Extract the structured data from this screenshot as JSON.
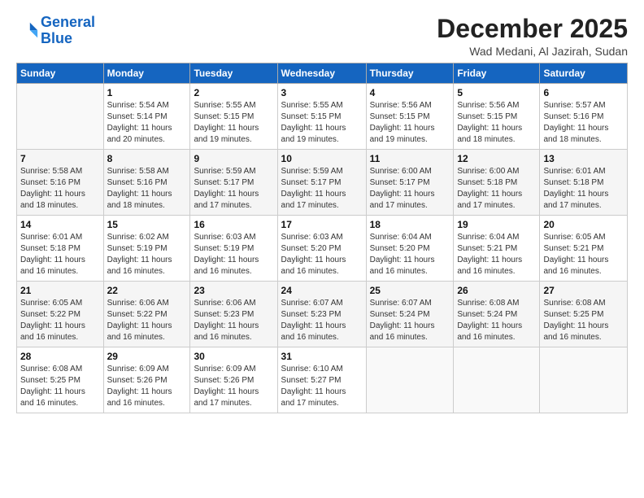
{
  "logo": {
    "line1": "General",
    "line2": "Blue"
  },
  "title": "December 2025",
  "location": "Wad Medani, Al Jazirah, Sudan",
  "days_of_week": [
    "Sunday",
    "Monday",
    "Tuesday",
    "Wednesday",
    "Thursday",
    "Friday",
    "Saturday"
  ],
  "weeks": [
    [
      {
        "day": "",
        "info": ""
      },
      {
        "day": "1",
        "info": "Sunrise: 5:54 AM\nSunset: 5:14 PM\nDaylight: 11 hours\nand 20 minutes."
      },
      {
        "day": "2",
        "info": "Sunrise: 5:55 AM\nSunset: 5:15 PM\nDaylight: 11 hours\nand 19 minutes."
      },
      {
        "day": "3",
        "info": "Sunrise: 5:55 AM\nSunset: 5:15 PM\nDaylight: 11 hours\nand 19 minutes."
      },
      {
        "day": "4",
        "info": "Sunrise: 5:56 AM\nSunset: 5:15 PM\nDaylight: 11 hours\nand 19 minutes."
      },
      {
        "day": "5",
        "info": "Sunrise: 5:56 AM\nSunset: 5:15 PM\nDaylight: 11 hours\nand 18 minutes."
      },
      {
        "day": "6",
        "info": "Sunrise: 5:57 AM\nSunset: 5:16 PM\nDaylight: 11 hours\nand 18 minutes."
      }
    ],
    [
      {
        "day": "7",
        "info": "Sunrise: 5:58 AM\nSunset: 5:16 PM\nDaylight: 11 hours\nand 18 minutes."
      },
      {
        "day": "8",
        "info": "Sunrise: 5:58 AM\nSunset: 5:16 PM\nDaylight: 11 hours\nand 18 minutes."
      },
      {
        "day": "9",
        "info": "Sunrise: 5:59 AM\nSunset: 5:17 PM\nDaylight: 11 hours\nand 17 minutes."
      },
      {
        "day": "10",
        "info": "Sunrise: 5:59 AM\nSunset: 5:17 PM\nDaylight: 11 hours\nand 17 minutes."
      },
      {
        "day": "11",
        "info": "Sunrise: 6:00 AM\nSunset: 5:17 PM\nDaylight: 11 hours\nand 17 minutes."
      },
      {
        "day": "12",
        "info": "Sunrise: 6:00 AM\nSunset: 5:18 PM\nDaylight: 11 hours\nand 17 minutes."
      },
      {
        "day": "13",
        "info": "Sunrise: 6:01 AM\nSunset: 5:18 PM\nDaylight: 11 hours\nand 17 minutes."
      }
    ],
    [
      {
        "day": "14",
        "info": "Sunrise: 6:01 AM\nSunset: 5:18 PM\nDaylight: 11 hours\nand 16 minutes."
      },
      {
        "day": "15",
        "info": "Sunrise: 6:02 AM\nSunset: 5:19 PM\nDaylight: 11 hours\nand 16 minutes."
      },
      {
        "day": "16",
        "info": "Sunrise: 6:03 AM\nSunset: 5:19 PM\nDaylight: 11 hours\nand 16 minutes."
      },
      {
        "day": "17",
        "info": "Sunrise: 6:03 AM\nSunset: 5:20 PM\nDaylight: 11 hours\nand 16 minutes."
      },
      {
        "day": "18",
        "info": "Sunrise: 6:04 AM\nSunset: 5:20 PM\nDaylight: 11 hours\nand 16 minutes."
      },
      {
        "day": "19",
        "info": "Sunrise: 6:04 AM\nSunset: 5:21 PM\nDaylight: 11 hours\nand 16 minutes."
      },
      {
        "day": "20",
        "info": "Sunrise: 6:05 AM\nSunset: 5:21 PM\nDaylight: 11 hours\nand 16 minutes."
      }
    ],
    [
      {
        "day": "21",
        "info": "Sunrise: 6:05 AM\nSunset: 5:22 PM\nDaylight: 11 hours\nand 16 minutes."
      },
      {
        "day": "22",
        "info": "Sunrise: 6:06 AM\nSunset: 5:22 PM\nDaylight: 11 hours\nand 16 minutes."
      },
      {
        "day": "23",
        "info": "Sunrise: 6:06 AM\nSunset: 5:23 PM\nDaylight: 11 hours\nand 16 minutes."
      },
      {
        "day": "24",
        "info": "Sunrise: 6:07 AM\nSunset: 5:23 PM\nDaylight: 11 hours\nand 16 minutes."
      },
      {
        "day": "25",
        "info": "Sunrise: 6:07 AM\nSunset: 5:24 PM\nDaylight: 11 hours\nand 16 minutes."
      },
      {
        "day": "26",
        "info": "Sunrise: 6:08 AM\nSunset: 5:24 PM\nDaylight: 11 hours\nand 16 minutes."
      },
      {
        "day": "27",
        "info": "Sunrise: 6:08 AM\nSunset: 5:25 PM\nDaylight: 11 hours\nand 16 minutes."
      }
    ],
    [
      {
        "day": "28",
        "info": "Sunrise: 6:08 AM\nSunset: 5:25 PM\nDaylight: 11 hours\nand 16 minutes."
      },
      {
        "day": "29",
        "info": "Sunrise: 6:09 AM\nSunset: 5:26 PM\nDaylight: 11 hours\nand 16 minutes."
      },
      {
        "day": "30",
        "info": "Sunrise: 6:09 AM\nSunset: 5:26 PM\nDaylight: 11 hours\nand 17 minutes."
      },
      {
        "day": "31",
        "info": "Sunrise: 6:10 AM\nSunset: 5:27 PM\nDaylight: 11 hours\nand 17 minutes."
      },
      {
        "day": "",
        "info": ""
      },
      {
        "day": "",
        "info": ""
      },
      {
        "day": "",
        "info": ""
      }
    ]
  ]
}
